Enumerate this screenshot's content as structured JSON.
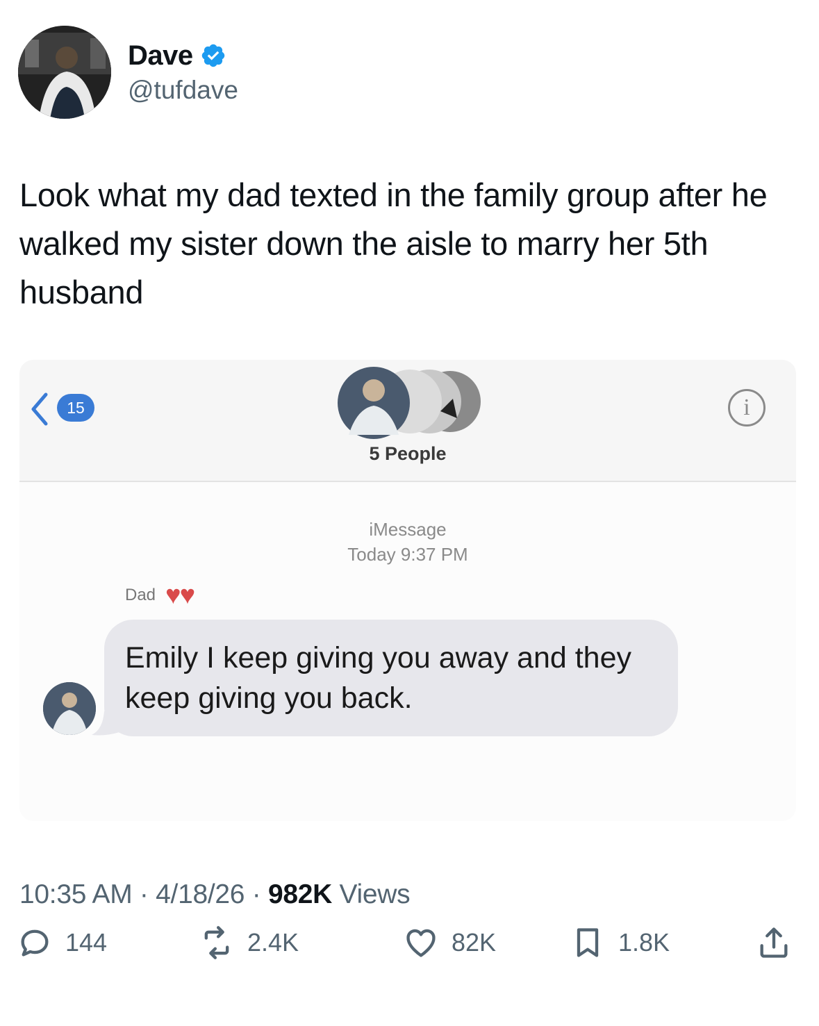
{
  "author": {
    "display_name": "Dave",
    "handle": "@tufdave",
    "verified_color": "#1d9bf0"
  },
  "tweet": {
    "text": "Look what my dad texted in the family group after he walked my sister down the aisle to marry her 5th husband"
  },
  "screenshot": {
    "back_badge": "15",
    "group_label": "5 People",
    "service": "iMessage",
    "timestamp": "Today 9:37 PM",
    "sender": "Dad",
    "message": "Emily I keep giving you away and they keep giving you back."
  },
  "meta": {
    "time": "10:35 AM",
    "date": "4/18/26",
    "sep": " · ",
    "views_count": "982K",
    "views_label": "Views"
  },
  "actions": {
    "replies": "144",
    "reposts": "2.4K",
    "likes": "82K",
    "bookmarks": "1.8K"
  }
}
